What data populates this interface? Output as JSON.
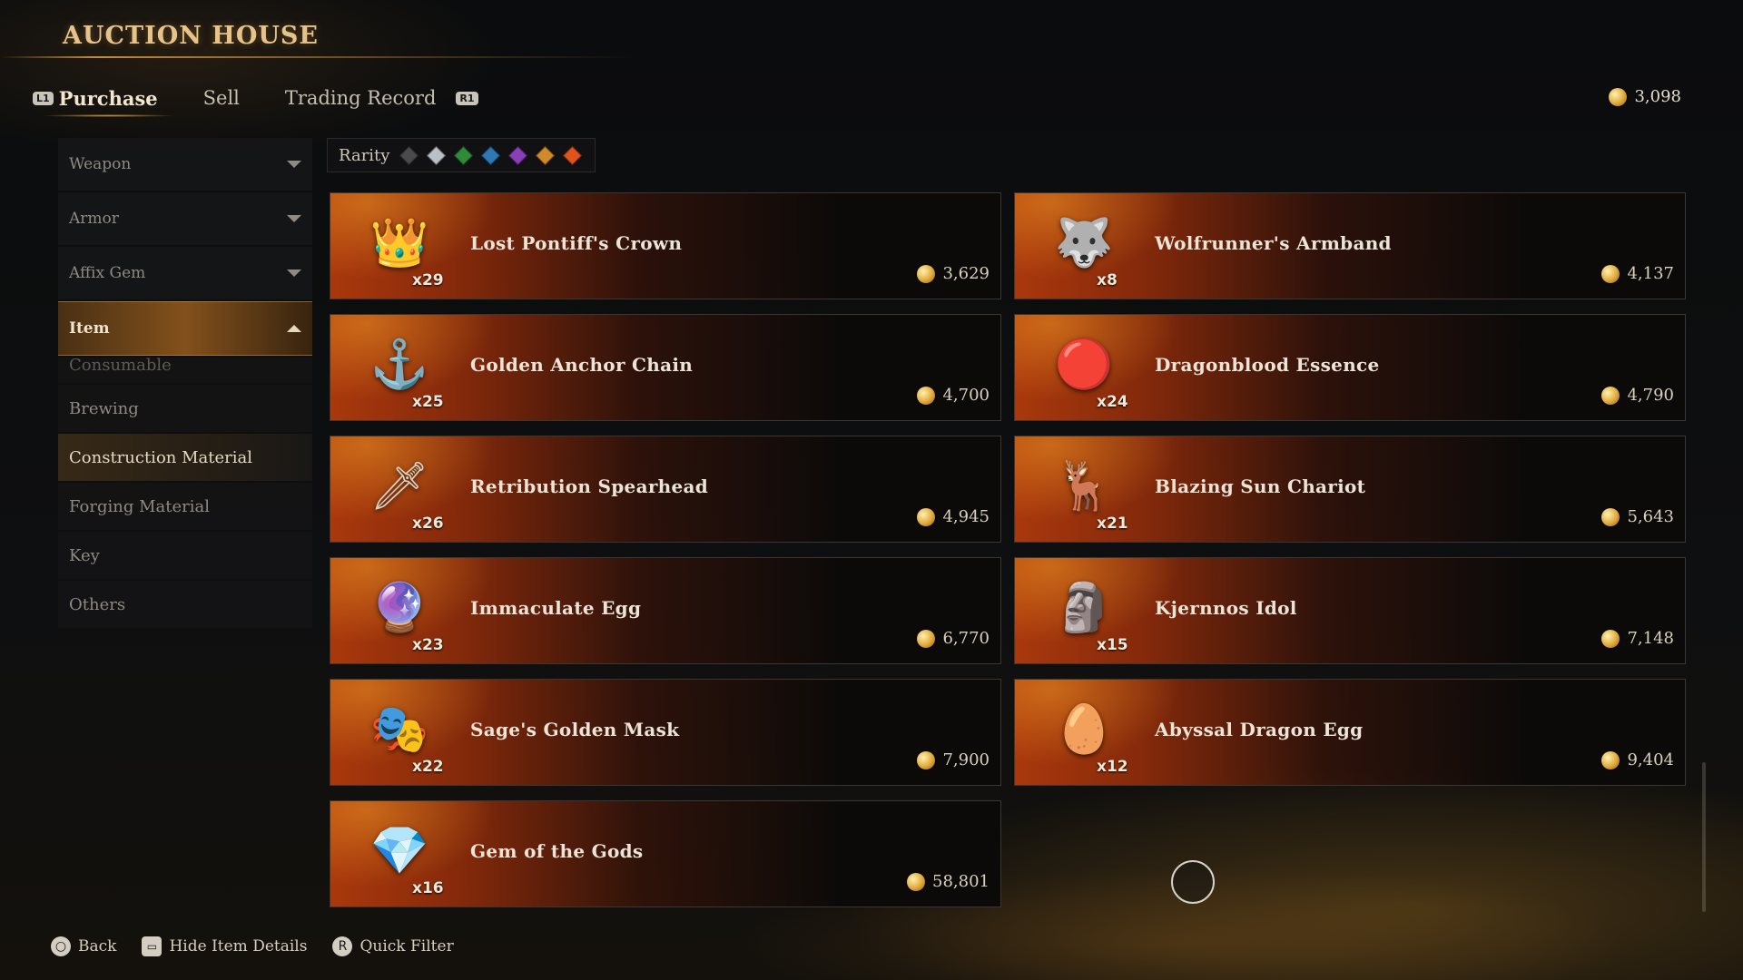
{
  "header": {
    "title": "AUCTION HOUSE"
  },
  "tabs": {
    "left_button": "L1",
    "right_button": "R1",
    "items": [
      {
        "label": "Purchase",
        "active": true
      },
      {
        "label": "Sell",
        "active": false
      },
      {
        "label": "Trading Record",
        "active": false
      }
    ]
  },
  "currency": {
    "icon": "gold-coin-icon",
    "amount": "3,098"
  },
  "sidebar": {
    "categories": [
      {
        "label": "Weapon",
        "expanded": false
      },
      {
        "label": "Armor",
        "expanded": false
      },
      {
        "label": "Affix Gem",
        "expanded": false
      },
      {
        "label": "Item",
        "expanded": true
      }
    ],
    "subcategories": [
      {
        "label": "Consumable",
        "partially_hidden": true
      },
      {
        "label": "Brewing"
      },
      {
        "label": "Construction Material",
        "highlighted": true
      },
      {
        "label": "Forging Material"
      },
      {
        "label": "Key"
      },
      {
        "label": "Others"
      }
    ]
  },
  "filter": {
    "rarity_label": "Rarity",
    "rarity_colors": [
      "#4a4a4a",
      "#b9c0c6",
      "#2f8a3a",
      "#2e78b8",
      "#8a3fb8",
      "#d08a2a",
      "#e0541c"
    ]
  },
  "listings": [
    {
      "name": "Lost Pontiff's Crown",
      "qty": "x29",
      "price": "3,629",
      "icon": "crown-icon",
      "glyph": "👑"
    },
    {
      "name": "Wolfrunner's Armband",
      "qty": "x8",
      "price": "4,137",
      "icon": "armband-icon",
      "glyph": "🐺"
    },
    {
      "name": "Golden Anchor Chain",
      "qty": "x25",
      "price": "4,700",
      "icon": "anchor-icon",
      "glyph": "⚓"
    },
    {
      "name": "Dragonblood Essence",
      "qty": "x24",
      "price": "4,790",
      "icon": "essence-icon",
      "glyph": "🔴"
    },
    {
      "name": "Retribution Spearhead",
      "qty": "x26",
      "price": "4,945",
      "icon": "spearhead-icon",
      "glyph": "🗡"
    },
    {
      "name": "Blazing Sun Chariot",
      "qty": "x21",
      "price": "5,643",
      "icon": "chariot-icon",
      "glyph": "🦌"
    },
    {
      "name": "Immaculate Egg",
      "qty": "x23",
      "price": "6,770",
      "icon": "red-egg-icon",
      "glyph": "🔮"
    },
    {
      "name": "Kjernnos Idol",
      "qty": "x15",
      "price": "7,148",
      "icon": "idol-icon",
      "glyph": "🗿"
    },
    {
      "name": "Sage's Golden Mask",
      "qty": "x22",
      "price": "7,900",
      "icon": "mask-icon",
      "glyph": "🎭"
    },
    {
      "name": "Abyssal Dragon Egg",
      "qty": "x12",
      "price": "9,404",
      "icon": "dragon-egg-icon",
      "glyph": "🥚"
    },
    {
      "name": "Gem of the Gods",
      "qty": "x16",
      "price": "58,801",
      "icon": "gem-icon",
      "glyph": "💎"
    }
  ],
  "footer": {
    "back": {
      "label": "Back",
      "icon": "circle-button-icon"
    },
    "hide_details": {
      "label": "Hide Item Details",
      "icon": "touchpad-icon"
    },
    "quick_filter": {
      "label": "Quick Filter",
      "icon": "r-stick-icon"
    }
  }
}
